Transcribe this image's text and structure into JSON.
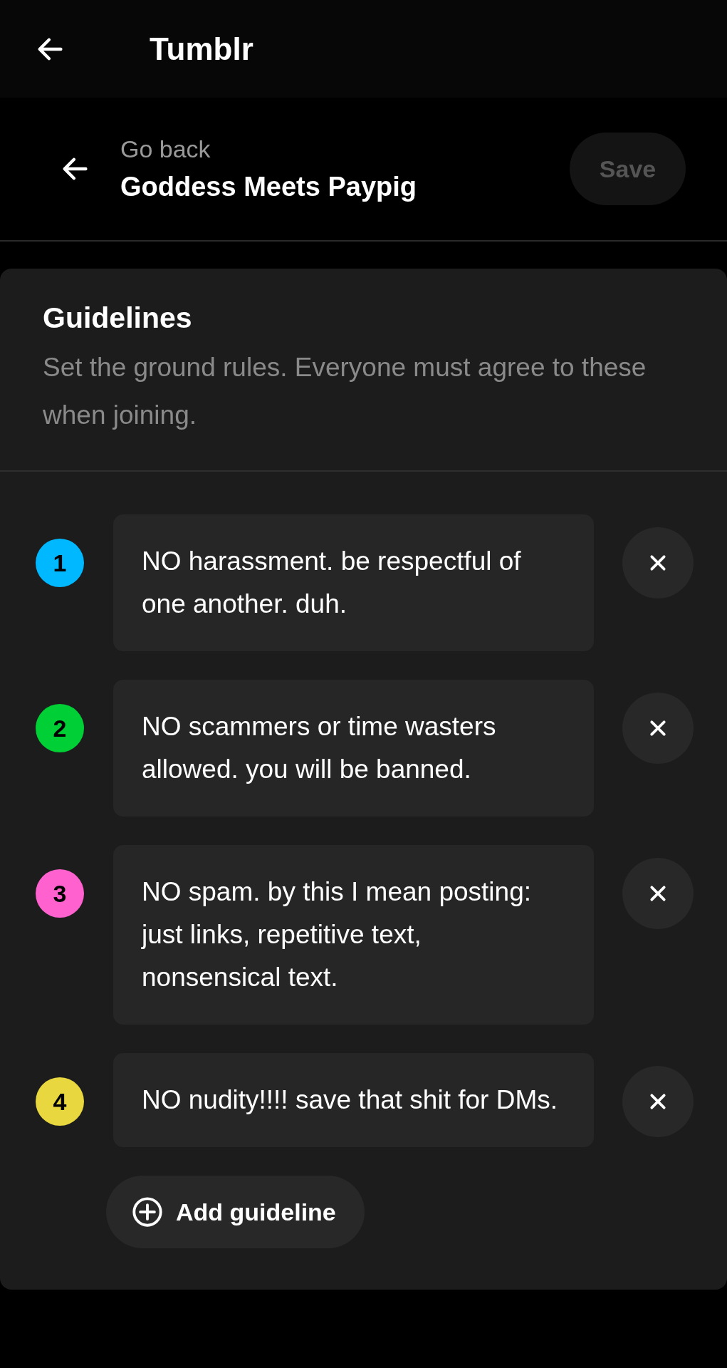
{
  "app_bar": {
    "title": "Tumblr"
  },
  "header": {
    "back_label": "Go back",
    "title": "Goddess Meets Paypig",
    "save_button": {
      "label": "Save",
      "disabled": true
    }
  },
  "guidelines": {
    "title": "Guidelines",
    "description": "Set the ground rules. Everyone must agree to these when joining.",
    "items": [
      {
        "number": "1",
        "color": "#00b8ff",
        "text": "NO harassment. be respectful of one another. duh."
      },
      {
        "number": "2",
        "color": "#00cf35",
        "text": "NO scammers or time wasters allowed. you will be banned."
      },
      {
        "number": "3",
        "color": "#ff62ce",
        "text": "NO spam. by this I mean posting: just links, repetitive text, nonsensical text."
      },
      {
        "number": "4",
        "color": "#e8d73e",
        "text": "NO nudity!!!! save that shit for DMs."
      }
    ],
    "add_button": "Add guideline"
  }
}
